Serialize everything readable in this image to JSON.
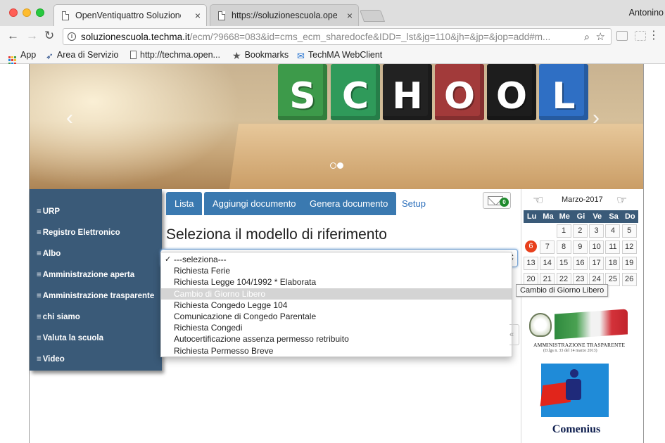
{
  "browser": {
    "tabs": [
      {
        "title": "OpenVentiquattro Soluzione Scuola",
        "active": true
      },
      {
        "title": "https://soluzionescuola.openventiquattro",
        "active": false
      }
    ],
    "profile_name": "Antonino",
    "url_host": "soluzionescuola.techma.it",
    "url_path": "/ecm/?9668=083&id=cms_ecm_sharedocfe&IDD=_lst&jg=110&jh=&jp=&jop=add#m...",
    "bookmarks": [
      {
        "label": "App",
        "icon": "apps-grid-icon"
      },
      {
        "label": "Area di Servizio",
        "icon": "bookmark-logo-icon"
      },
      {
        "label": "http://techma.open...",
        "icon": "page-icon"
      },
      {
        "label": "Bookmarks",
        "icon": "star-icon"
      },
      {
        "label": "TechMA WebClient",
        "icon": "mail-icon"
      }
    ]
  },
  "banner": {
    "letters": [
      "S",
      "C",
      "H",
      "O",
      "O",
      "L"
    ],
    "block_colors": [
      "#3d9a4a",
      "#2f9a5a",
      "#222222",
      "#a23a3a",
      "#1d1d1d",
      "#2f6fc4"
    ]
  },
  "sidebar": {
    "items": [
      "URP",
      "Registro Elettronico",
      "Albo",
      "Amministrazione aperta",
      "Amministrazione trasparente",
      "chi siamo",
      "Valuta la scuola",
      "Video"
    ]
  },
  "main": {
    "tabs": [
      "Lista",
      "Aggiungi documento",
      "Genera documento"
    ],
    "setup_label": "Setup",
    "mail_count": "0",
    "heading": "Seleziona il modello di riferimento",
    "options": [
      "---seleziona---",
      "Richiesta Ferie",
      "Richiesta Legge 104/1992 * Elaborata",
      "Cambio di Giorno Libero",
      "Richiesta Congedo Legge 104",
      "Comunicazione di Congedo Parentale",
      "Richiesta Congedi",
      "Autocertificazione assenza permesso retribuito",
      "Richiesta Permesso Breve"
    ],
    "selected_option": "---seleziona---",
    "highlighted_option": "Cambio di Giorno Libero",
    "tooltip": "Cambio di Giorno Libero"
  },
  "calendar": {
    "month_label": "Marzo-2017",
    "weekdays": [
      "Lu",
      "Ma",
      "Me",
      "Gi",
      "Ve",
      "Sa",
      "Do"
    ],
    "weeks": [
      [
        "",
        "",
        "1",
        "2",
        "3",
        "4",
        "5"
      ],
      [
        "6",
        "7",
        "8",
        "9",
        "10",
        "11",
        "12"
      ],
      [
        "13",
        "14",
        "15",
        "16",
        "17",
        "18",
        "19"
      ],
      [
        "20",
        "21",
        "22",
        "23",
        "24",
        "25",
        "26"
      ]
    ],
    "today": "6"
  },
  "widgets": {
    "amministrazione_text": "AMMINISTRAZIONE TRASPARENTE",
    "amministrazione_sub": "(D.lgs n. 33 del 14 marzo 2013)",
    "comenius_label": "Comenius"
  },
  "colors": {
    "accent_blue": "#3a79b0",
    "sidebar_bg": "#3a5a78",
    "today_red": "#e8401c"
  }
}
